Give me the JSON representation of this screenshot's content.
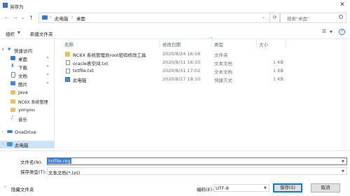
{
  "window": {
    "title": "另存为",
    "close_glyph": "✕"
  },
  "nav": {
    "back_glyph": "←",
    "forward_glyph": "→",
    "recent_glyph": "⌄",
    "up_glyph": "↑",
    "breadcrumb": [
      "此电脑",
      "桌面"
    ],
    "chevron": "›",
    "refresh_glyph": "⟳",
    "search_placeholder": "搜索\"桌面\""
  },
  "toolbar": {
    "organize_label": "组织",
    "new_folder_label": "新建文件夹",
    "view_glyph": "☰",
    "help_glyph": "?"
  },
  "sidebar": {
    "items": [
      {
        "label": "快速访问",
        "icon": "star-icon",
        "color": "#2b7bd9"
      },
      {
        "label": "桌面",
        "icon": "desktop-icon",
        "color": "#2b7bd9",
        "pinned": true
      },
      {
        "label": "下载",
        "icon": "download-icon",
        "color": "#2b7bd9",
        "pinned": true
      },
      {
        "label": "文档",
        "icon": "document-icon",
        "color": "#7a8aa0",
        "pinned": true
      },
      {
        "label": "图片",
        "icon": "picture-icon",
        "color": "#3b8ed8",
        "pinned": true
      },
      {
        "label": "Java",
        "icon": "folder-icon",
        "color": "#e8c15a"
      },
      {
        "label": "NC6X 系统管理",
        "icon": "folder-icon",
        "color": "#e8c15a"
      },
      {
        "label": "yonyou",
        "icon": "folder-icon",
        "color": "#e8c15a"
      },
      {
        "label": "音乐",
        "icon": "music-icon",
        "color": "#3b8ed8"
      },
      {
        "label": "OneDrive",
        "icon": "cloud-icon",
        "color": "#2b7bd9"
      },
      {
        "label": "此电脑",
        "icon": "computer-icon",
        "color": "#4a90d9",
        "selected": true
      }
    ],
    "pin_glyph": "📌"
  },
  "columns": {
    "name": "名称",
    "date": "修改日期",
    "type": "类型",
    "size": "大小",
    "sort_glyph": "^"
  },
  "files": [
    {
      "name": "NC6X 系统管理员root密码修改工具",
      "date": "2020/8/24 16:58",
      "type": "文件夹",
      "size": "",
      "icon": "folder-icon"
    },
    {
      "name": "oracle表空间.txt",
      "date": "2020/8/31 16:10",
      "type": "文本文档",
      "size": "1 KB",
      "icon": "text-file-icon"
    },
    {
      "name": "txtfile.txt",
      "date": "2020/8/31 17:02",
      "type": "文本文档",
      "size": "1 KB",
      "icon": "text-file-icon"
    },
    {
      "name": "此电脑",
      "date": "2020/8/27 19:10",
      "type": "快捷方式",
      "size": "1 KB",
      "icon": "shortcut-icon"
    }
  ],
  "form": {
    "filename_label": "文件名(N):",
    "filename_value": "txtfile.reg",
    "savetype_label": "保存类型(T):",
    "savetype_value": "文本文档(*.txt)"
  },
  "footer": {
    "hide_folders_label": "隐藏文件夹",
    "encoding_label": "编码(E):",
    "encoding_value": "UTF-8",
    "save_label": "保存(S)",
    "cancel_label": "取消"
  },
  "colors": {
    "accent": "#3b78d8",
    "selection": "#cce4f7",
    "folder": "#e8c15a"
  }
}
